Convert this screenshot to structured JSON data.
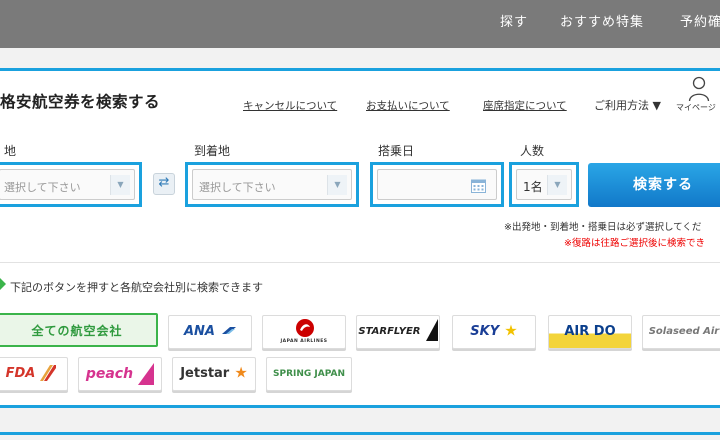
{
  "nav": {
    "items": [
      {
        "label": "探す"
      },
      {
        "label": "おすすめ特集"
      },
      {
        "label": "予約確"
      }
    ]
  },
  "search": {
    "title": "格安航空券を検索する",
    "links": [
      {
        "label": "キャンセルについて"
      },
      {
        "label": "お支払いについて"
      },
      {
        "label": "座席指定について"
      }
    ],
    "usage_label": "ご利用方法 ▼",
    "mypage_label": "マイページ",
    "fields": {
      "origin": {
        "label": "地",
        "placeholder": "選択して下さい"
      },
      "destination": {
        "label": "到着地",
        "placeholder": "選択して下さい"
      },
      "date": {
        "label": "搭乗日",
        "value": ""
      },
      "passengers": {
        "label": "人数",
        "value": "1名"
      }
    },
    "swap_icon": "⇄",
    "submit_label": "検索する",
    "note_required": "※出発地・到着地・搭乗日は必ず選択してくだ",
    "note_return": "※復路は往路ご選択後に検索でき"
  },
  "airlines": {
    "heading": "下記のボタンを押すと各航空会社別に検索できます",
    "all_label": "全ての航空会社",
    "items": [
      {
        "name": "ANA",
        "color": "#1a4fa0"
      },
      {
        "name": "JAPAN AIRLINES",
        "color": "#cc0000"
      },
      {
        "name": "STARFLYER",
        "color": "#222222"
      },
      {
        "name": "SKY",
        "color": "#1a3e96"
      },
      {
        "name": "AIR DO",
        "color": "#0b3f8c"
      },
      {
        "name": "Solaseed Air",
        "color": "#777777"
      },
      {
        "name": "FDA",
        "color": "#d4352a"
      },
      {
        "name": "peach",
        "color": "#d6338f"
      },
      {
        "name": "Jetstar",
        "color": "#333333"
      },
      {
        "name": "SPRING JAPAN",
        "color": "#3f8f4a"
      }
    ]
  },
  "colors": {
    "accent": "#1aa1de",
    "header": "#7a7a7a",
    "all_airlines_green": "#3bb44a",
    "notice_red": "#ee0000"
  }
}
